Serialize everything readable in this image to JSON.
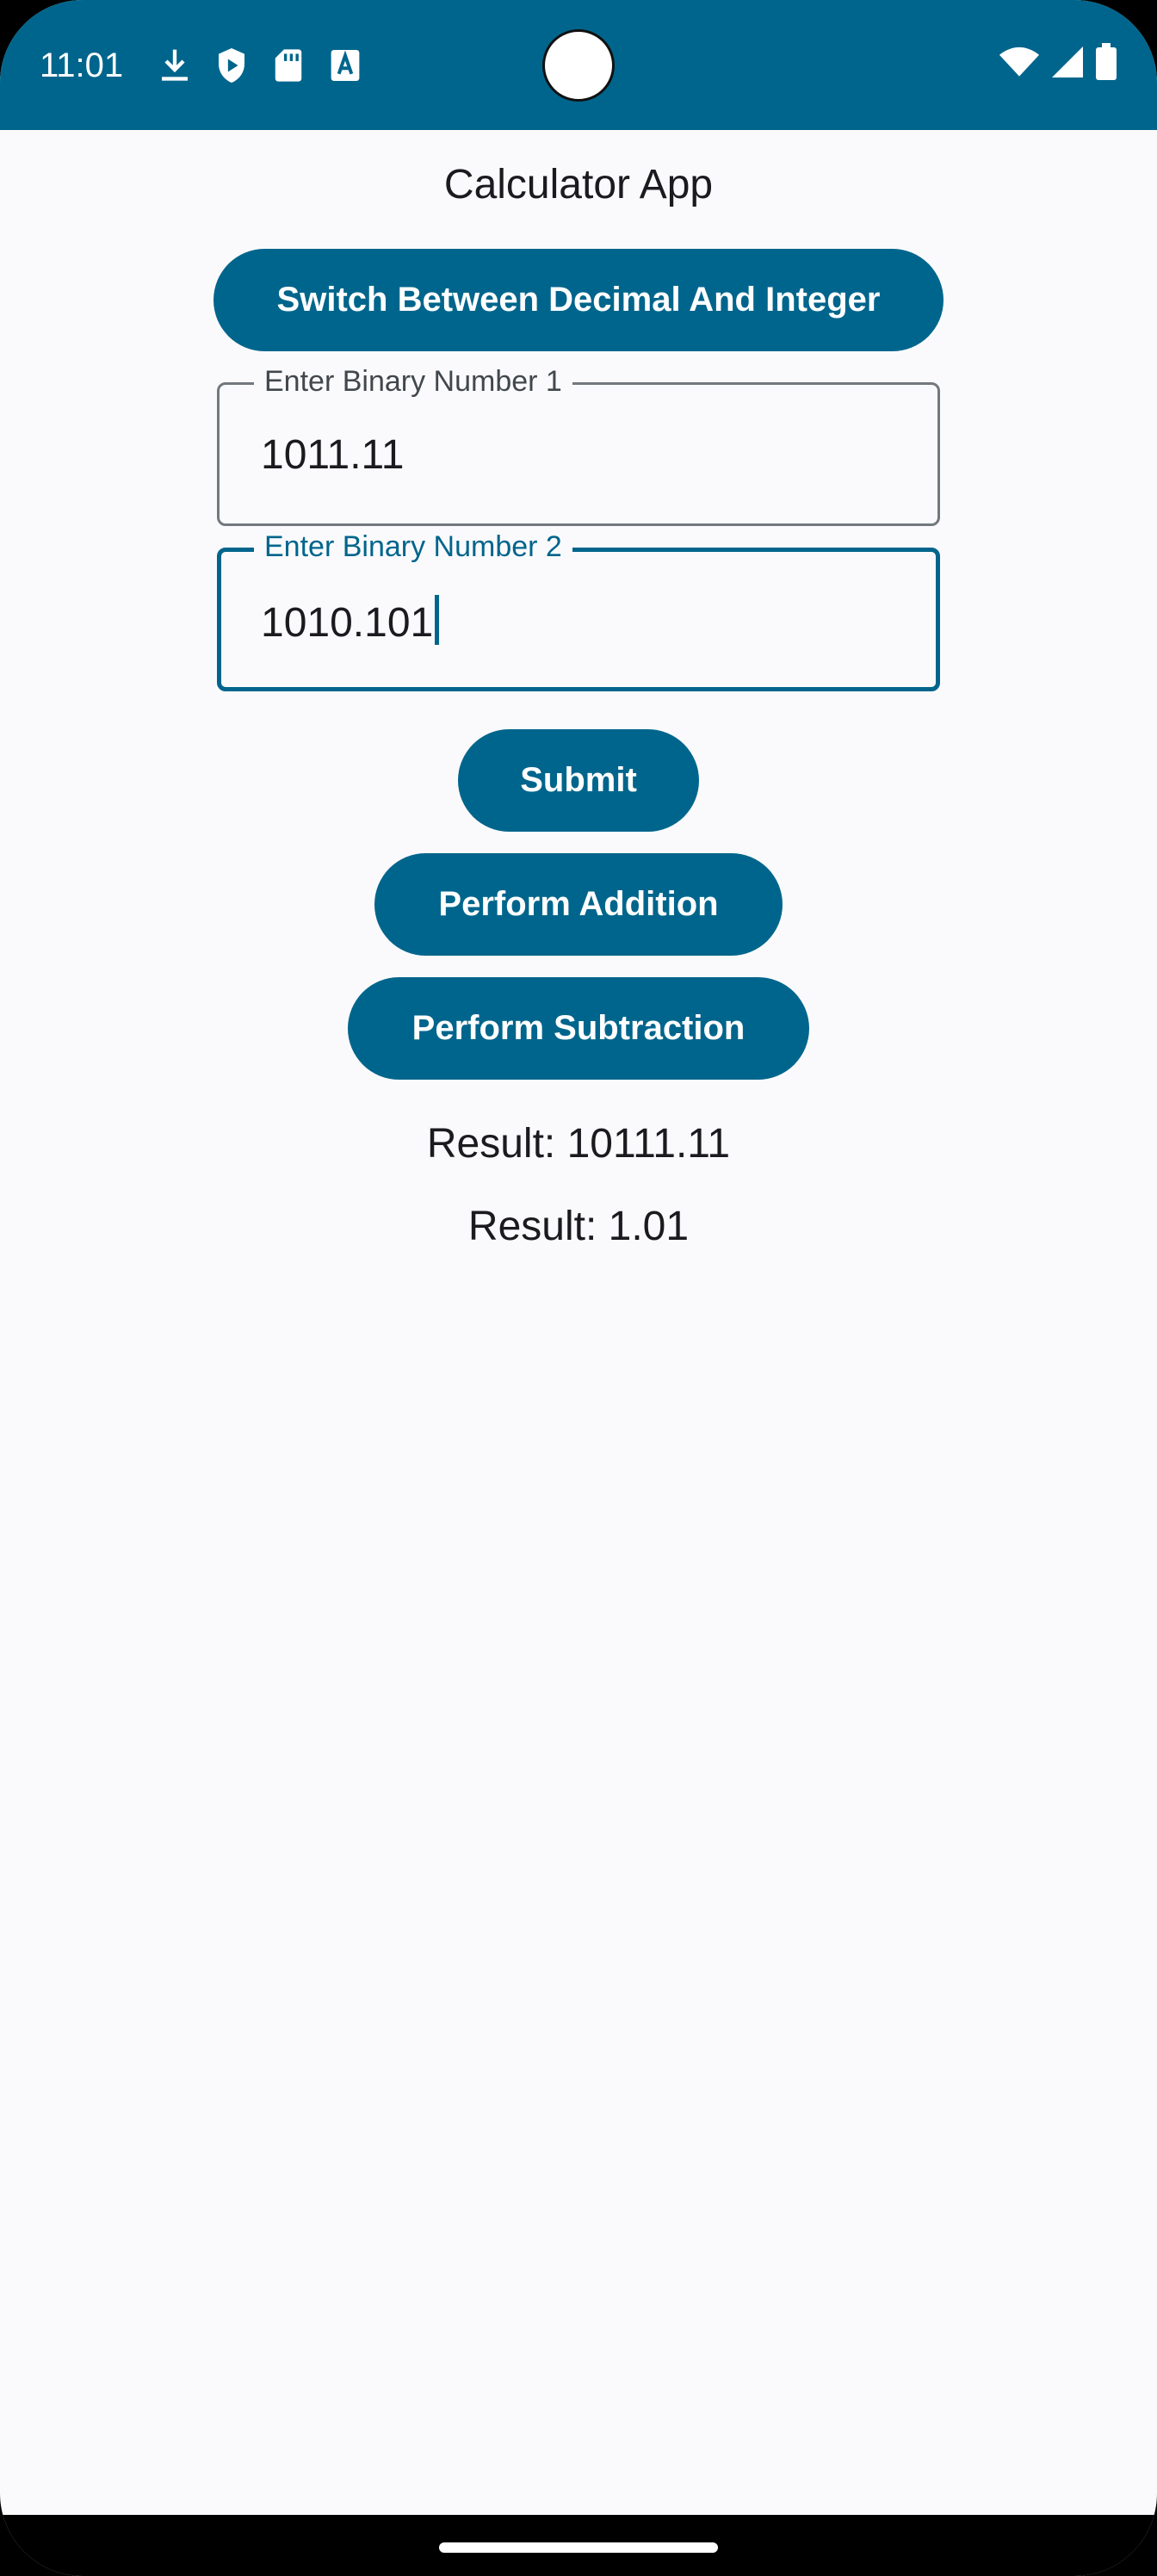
{
  "status_bar": {
    "time": "11:01",
    "left_icons": [
      "download-icon",
      "shield-play-icon",
      "sd-card-icon",
      "text-a-icon"
    ],
    "right_icons": [
      "wifi-icon",
      "signal-icon",
      "battery-icon"
    ],
    "background": "#00658c"
  },
  "app": {
    "title": "Calculator App",
    "switch_button": "Switch Between Decimal And Integer",
    "field1": {
      "label": "Enter Binary Number 1",
      "value": "1011.11"
    },
    "field2": {
      "label": "Enter Binary Number 2",
      "value": "1010.101"
    },
    "submit_button": "Submit",
    "addition_button": "Perform Addition",
    "subtraction_button": "Perform Subtraction",
    "result_addition": "Result: 10111.11",
    "result_subtraction": "Result: 1.01"
  },
  "colors": {
    "primary": "#00658c",
    "background": "#fafafc",
    "text": "#1b1b1f"
  }
}
